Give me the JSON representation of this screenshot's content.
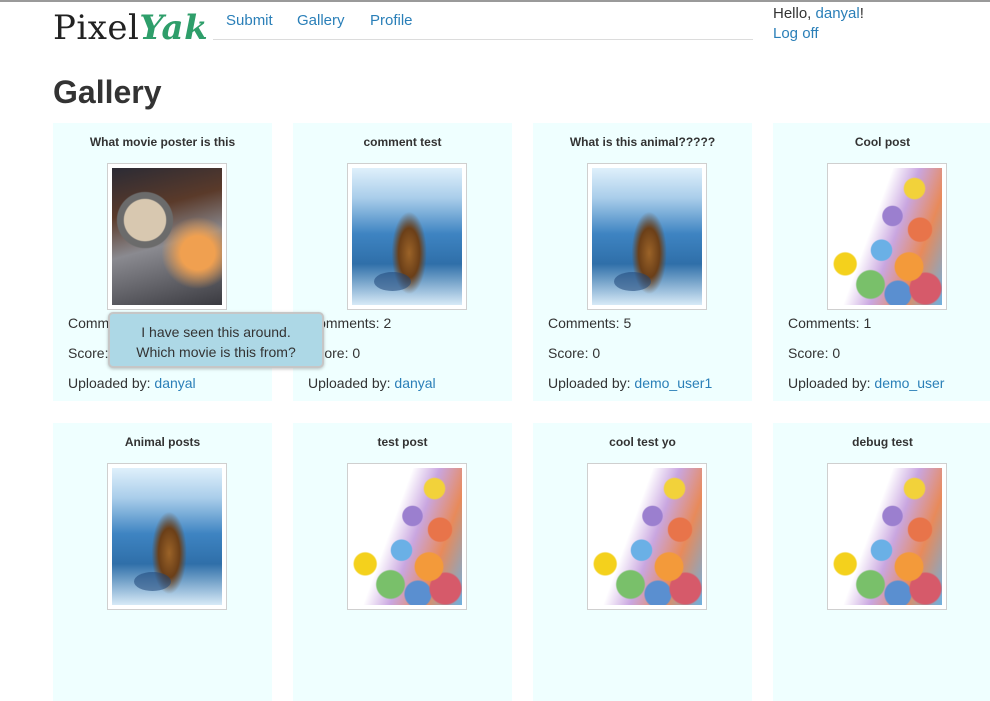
{
  "brand": {
    "part1": "Pixel",
    "part2": "Yak"
  },
  "nav": {
    "items": [
      "Submit",
      "Gallery",
      "Profile"
    ]
  },
  "user": {
    "greeting": "Hello, ",
    "username": "danyal",
    "exclaim": "!",
    "logoff": "Log off"
  },
  "page": {
    "title": "Gallery"
  },
  "labels": {
    "comments": "Comments: ",
    "score": "Score: ",
    "uploaded_by": "Uploaded by: "
  },
  "posts": [
    {
      "title": "What movie poster is this",
      "image": "movie-poster",
      "comments": "",
      "score": "",
      "uploader": "danyal"
    },
    {
      "title": "comment test",
      "image": "tiger-snow",
      "comments": "2",
      "score": "0",
      "uploader": "danyal"
    },
    {
      "title": "What is this animal?????",
      "image": "tiger-snow",
      "comments": "5",
      "score": "0",
      "uploader": "demo_user1"
    },
    {
      "title": "Cool post",
      "image": "pokemon-collage",
      "comments": "1",
      "score": "0",
      "uploader": "demo_user"
    },
    {
      "title": "Animal posts",
      "image": "tiger-snow"
    },
    {
      "title": "test post",
      "image": "pokemon-collage"
    },
    {
      "title": "cool test yo",
      "image": "pokemon-collage"
    },
    {
      "title": "debug test",
      "image": "pokemon-collage"
    }
  ],
  "tooltip": {
    "text": "I have seen this around. Which movie is this from?"
  },
  "colors": {
    "card_bg": "#efffff",
    "link": "#2a7fb8",
    "tooltip_bg": "#add8e6",
    "brand_accent": "#2e9e6a"
  }
}
